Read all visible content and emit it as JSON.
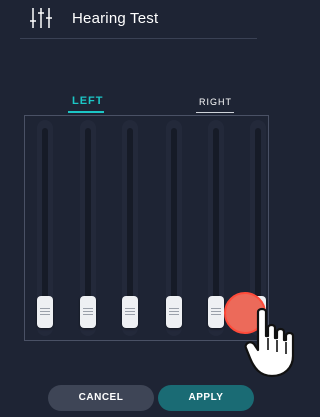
{
  "header": {
    "title": "Hearing Test",
    "icon": "equalizer-icon"
  },
  "tabs": {
    "left": "LEFT",
    "right": "RIGHT",
    "active": "LEFT"
  },
  "sliders": [
    {
      "name": "band-1",
      "level": 0.0
    },
    {
      "name": "band-2",
      "level": 0.0
    },
    {
      "name": "band-3",
      "level": 0.0
    },
    {
      "name": "band-4",
      "level": 0.0
    },
    {
      "name": "band-5",
      "level": 0.0
    },
    {
      "name": "band-6",
      "level": 0.0
    }
  ],
  "buttons": {
    "cancel": "CANCEL",
    "apply": "APPLY"
  },
  "colors": {
    "accent": "#1cc6c6",
    "apply_bg": "#1a6b74",
    "tap_indicator": "#ec6a5a",
    "background": "#1e2434"
  }
}
